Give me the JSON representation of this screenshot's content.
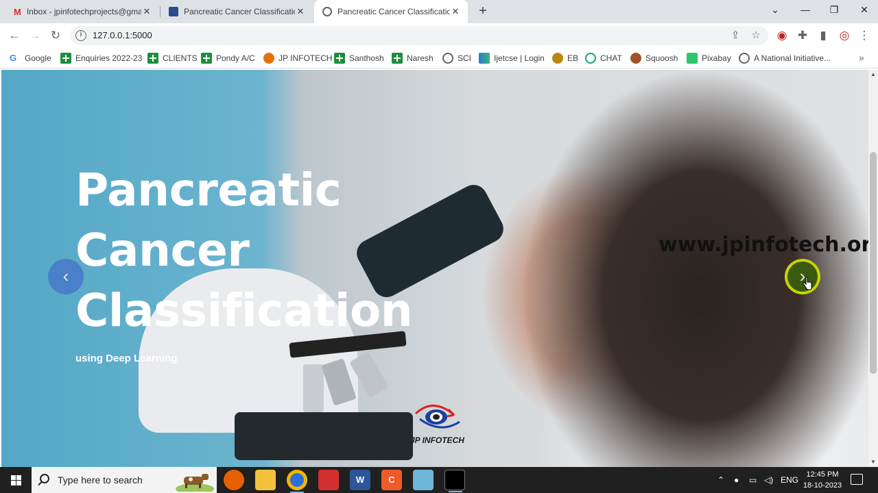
{
  "browser": {
    "tabs": [
      {
        "title": "Inbox - jpinfotechprojects@gma",
        "icon": "gmail-icon",
        "active": false
      },
      {
        "title": "Pancreatic Cancer Classification",
        "icon": "ieee-icon",
        "active": false
      },
      {
        "title": "Pancreatic Cancer Classification",
        "icon": "globe-icon",
        "active": true
      }
    ],
    "new_tab_label": "+",
    "url": "127.0.0.1:5000"
  },
  "bookmarks": [
    {
      "label": "Google",
      "icon": "google-icon"
    },
    {
      "label": "Enquiries 2022-23",
      "icon": "sheets-icon"
    },
    {
      "label": "CLIENTS",
      "icon": "sheets-icon"
    },
    {
      "label": "Pondy A/C",
      "icon": "sheets-icon"
    },
    {
      "label": "JP INFOTECH",
      "icon": "jp-icon"
    },
    {
      "label": "Santhosh",
      "icon": "sheets-icon"
    },
    {
      "label": "Naresh",
      "icon": "sheets-icon"
    },
    {
      "label": "SCI",
      "icon": "globe-icon"
    },
    {
      "label": "Ijetcse | Login",
      "icon": "ijetcse-icon"
    },
    {
      "label": "EB",
      "icon": "eb-icon"
    },
    {
      "label": "CHAT",
      "icon": "chatgpt-icon"
    },
    {
      "label": "Squoosh",
      "icon": "squoosh-icon"
    },
    {
      "label": "Pixabay",
      "icon": "pixabay-icon"
    },
    {
      "label": "A National Initiative...",
      "icon": "globe-icon"
    }
  ],
  "hero": {
    "title_lines": [
      "Pancreatic",
      "Cancer",
      "Classification"
    ],
    "subtitle": "using Deep Learning",
    "watermark": "www.jpinfotech.org",
    "logo_text": "JP INFOTECH",
    "prev_label": "‹",
    "next_label": "›"
  },
  "taskbar": {
    "search_placeholder": "Type here to search",
    "language": "ENG",
    "time": "12:45 PM",
    "date": "18-10-2023"
  },
  "colors": {
    "nav_prev": "#4a7fc9",
    "nav_next_ring": "#c9d400",
    "taskbar": "#202020"
  }
}
